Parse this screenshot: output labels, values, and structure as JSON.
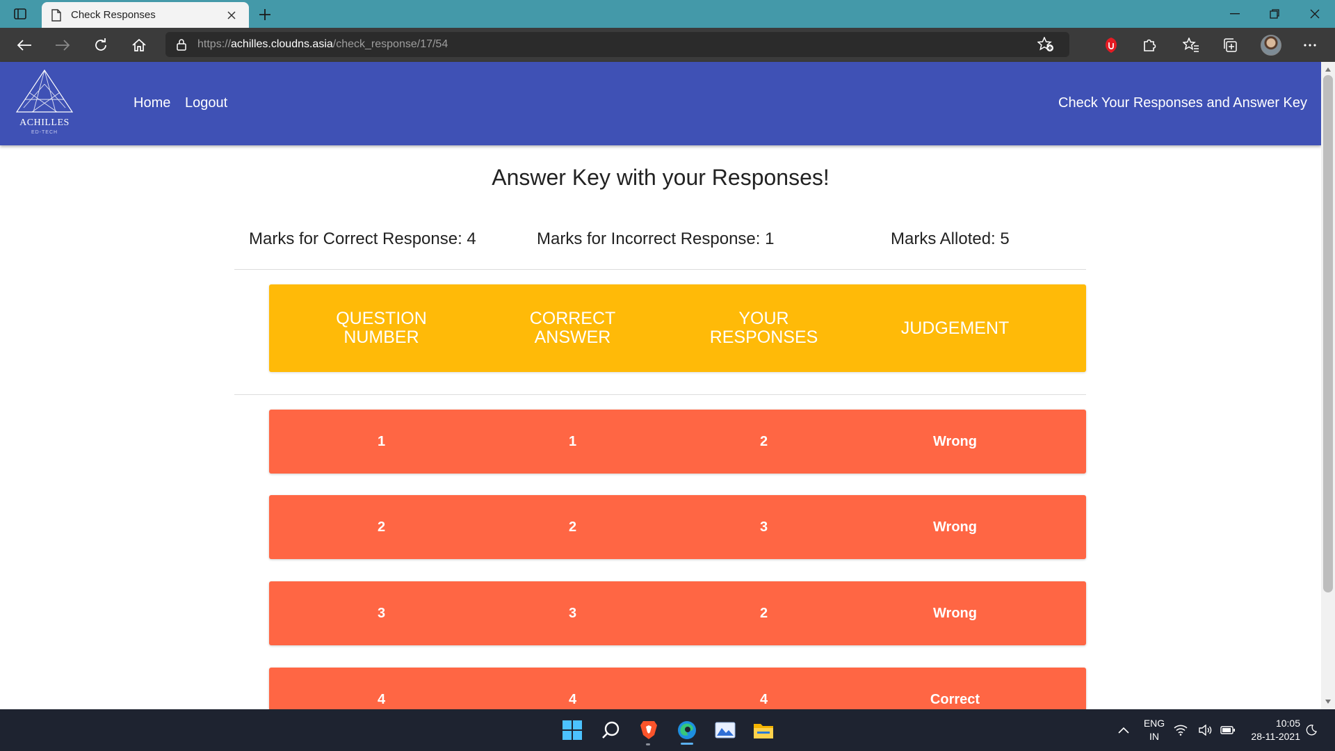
{
  "browser": {
    "tab_title": "Check Responses",
    "url_scheme": "https://",
    "url_host": "achilles.cloudns.asia",
    "url_path": "/check_response/17/54"
  },
  "site": {
    "logo_name": "ACHILLES",
    "logo_sub": "ED-TECH",
    "nav": [
      "Home",
      "Logout"
    ],
    "header_right": "Check Your Responses and Answer Key",
    "brand_color": "#3f51b5"
  },
  "page": {
    "title": "Answer Key with your Responses!",
    "marks_correct": "Marks for Correct Response: 4",
    "marks_incorrect": "Marks for Incorrect Response: 1",
    "marks_alloted": "Marks Alloted: 5"
  },
  "table": {
    "header_color": "#ffba08",
    "row_color": "#ff6644",
    "headers": [
      "QUESTION\nNUMBER",
      "CORRECT\nANSWER",
      "YOUR\nRESPONSES",
      "JUDGEMENT"
    ],
    "rows": [
      [
        "1",
        "1",
        "2",
        "Wrong"
      ],
      [
        "2",
        "2",
        "3",
        "Wrong"
      ],
      [
        "3",
        "3",
        "2",
        "Wrong"
      ],
      [
        "4",
        "4",
        "4",
        "Correct"
      ]
    ]
  },
  "taskbar": {
    "lang_top": "ENG",
    "lang_bottom": "IN",
    "time": "10:05",
    "date": "28-11-2021",
    "apps": [
      "windows-start-icon",
      "search-icon",
      "brave-browser-icon",
      "edge-browser-icon",
      "photos-icon",
      "file-explorer-icon"
    ]
  }
}
